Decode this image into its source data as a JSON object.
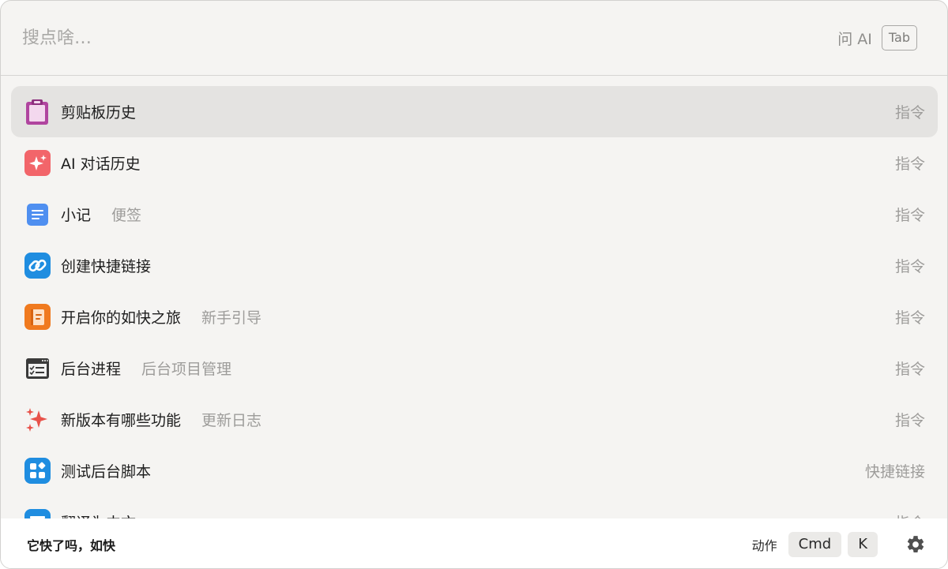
{
  "search": {
    "placeholder": "搜点啥…",
    "ask_ai_label": "问 AI",
    "tab_key": "Tab"
  },
  "results": [
    {
      "title": "剪贴板历史",
      "subtitle": "",
      "kind": "指令",
      "icon": "clipboard-icon",
      "selected": true
    },
    {
      "title": "AI 对话历史",
      "subtitle": "",
      "kind": "指令",
      "icon": "ai-chat-icon"
    },
    {
      "title": "小记",
      "subtitle": "便签",
      "kind": "指令",
      "icon": "note-icon"
    },
    {
      "title": "创建快捷链接",
      "subtitle": "",
      "kind": "指令",
      "icon": "link-icon"
    },
    {
      "title": "开启你的如快之旅",
      "subtitle": "新手引导",
      "kind": "指令",
      "icon": "guide-icon"
    },
    {
      "title": "后台进程",
      "subtitle": "后台项目管理",
      "kind": "指令",
      "icon": "background-process-icon"
    },
    {
      "title": "新版本有哪些功能",
      "subtitle": "更新日志",
      "kind": "指令",
      "icon": "sparkles-icon"
    },
    {
      "title": "测试后台脚本",
      "subtitle": "",
      "kind": "快捷链接",
      "icon": "apps-grid-icon"
    },
    {
      "title": "翻译为中文",
      "subtitle": "",
      "kind": "指令",
      "icon": "translate-icon"
    }
  ],
  "footer": {
    "slogan": "它快了吗，如快",
    "action_label": "动作",
    "keys": [
      "Cmd",
      "K"
    ],
    "settings_icon": "gear-icon"
  },
  "colors": {
    "window_bg": "#f5f4f2",
    "selected_row_bg": "#e4e3e1",
    "clipboard_purple": "#b0459f",
    "ai_red": "#f2656a",
    "note_blue": "#4f8ff0",
    "link_blue": "#1f8de0",
    "guide_orange": "#f07a1f",
    "sparkle_red": "#e8524a"
  }
}
